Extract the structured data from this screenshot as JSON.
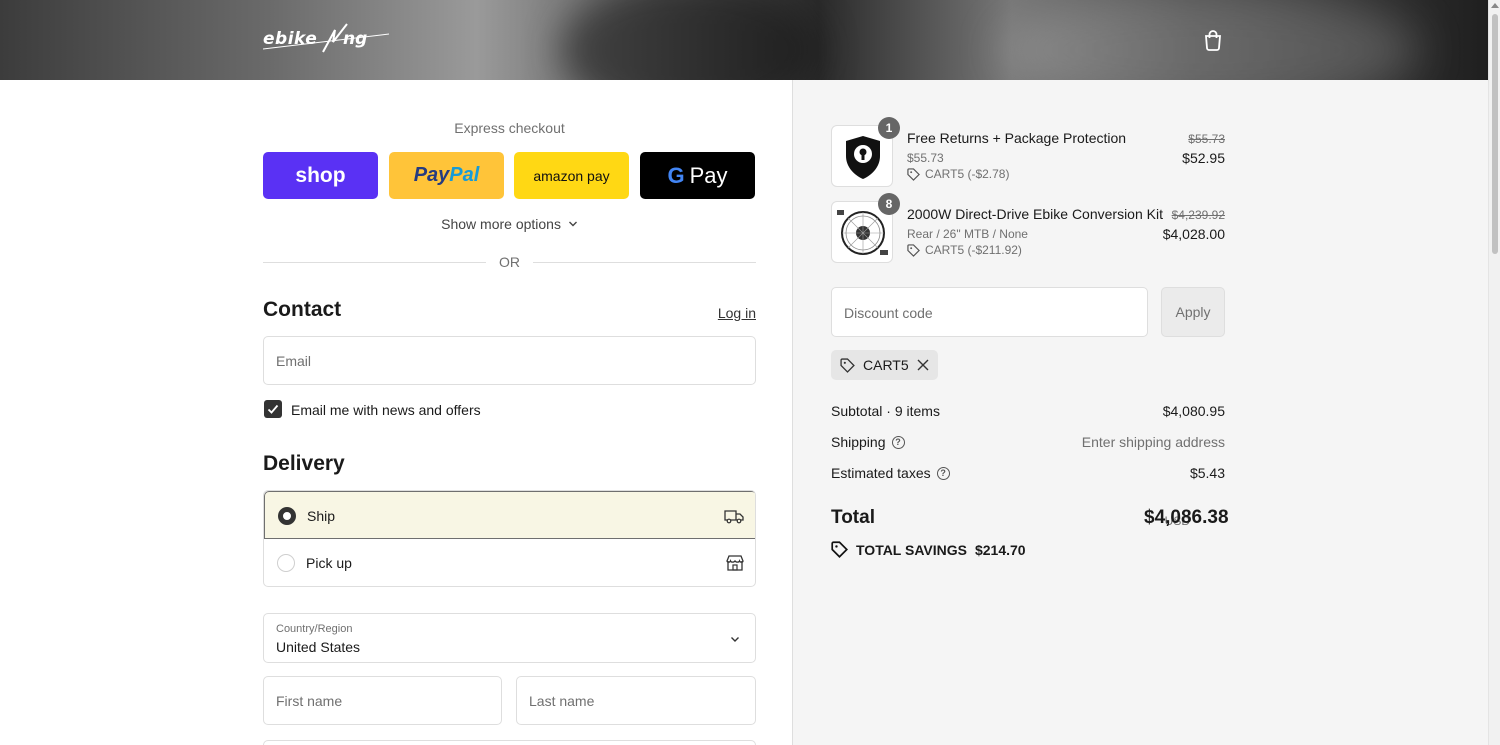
{
  "brand": {
    "logo_text": "ebikeling"
  },
  "express": {
    "label": "Express checkout",
    "buttons": {
      "shop": "shop",
      "paypal_a": "Pay",
      "paypal_b": "Pal",
      "amazon": "amazon pay",
      "gpay": "Pay"
    },
    "show_more": "Show more options",
    "or": "OR"
  },
  "contact": {
    "title": "Contact",
    "login": "Log in",
    "email_placeholder": "Email",
    "newsletter_label": "Email me with news and offers",
    "newsletter_checked": true
  },
  "delivery": {
    "title": "Delivery",
    "options": [
      {
        "label": "Ship",
        "selected": true
      },
      {
        "label": "Pick up",
        "selected": false
      }
    ],
    "country_label": "Country/Region",
    "country_value": "United States",
    "first_name_placeholder": "First name",
    "last_name_placeholder": "Last name"
  },
  "summary": {
    "items": [
      {
        "qty": "1",
        "title": "Free Returns + Package Protection",
        "subtitle": "$55.73",
        "code": "CART5 (-$2.78)",
        "price_old": "$55.73",
        "price_new": "$52.95"
      },
      {
        "qty": "8",
        "title": "2000W Direct-Drive Ebike Conversion Kit",
        "subtitle": "Rear / 26\" MTB / None",
        "code": "CART5 (-$211.92)",
        "price_old": "$4,239.92",
        "price_new": "$4,028.00"
      }
    ],
    "discount_placeholder": "Discount code",
    "apply_label": "Apply",
    "applied_code": "CART5",
    "subtotal_label": "Subtotal · 9 items",
    "subtotal_value": "$4,080.95",
    "shipping_label": "Shipping",
    "shipping_value": "Enter shipping address",
    "taxes_label": "Estimated taxes",
    "taxes_value": "$5.43",
    "total_label": "Total",
    "total_currency": "USD",
    "total_value": "$4,086.38",
    "savings_label": "TOTAL SAVINGS",
    "savings_value": "$214.70"
  },
  "colors": {
    "shop": "#5a31f4",
    "paypal": "#ffc439",
    "amazon": "#ffd814",
    "gpay": "#000000",
    "selected_bg": "#f8f6e4"
  }
}
